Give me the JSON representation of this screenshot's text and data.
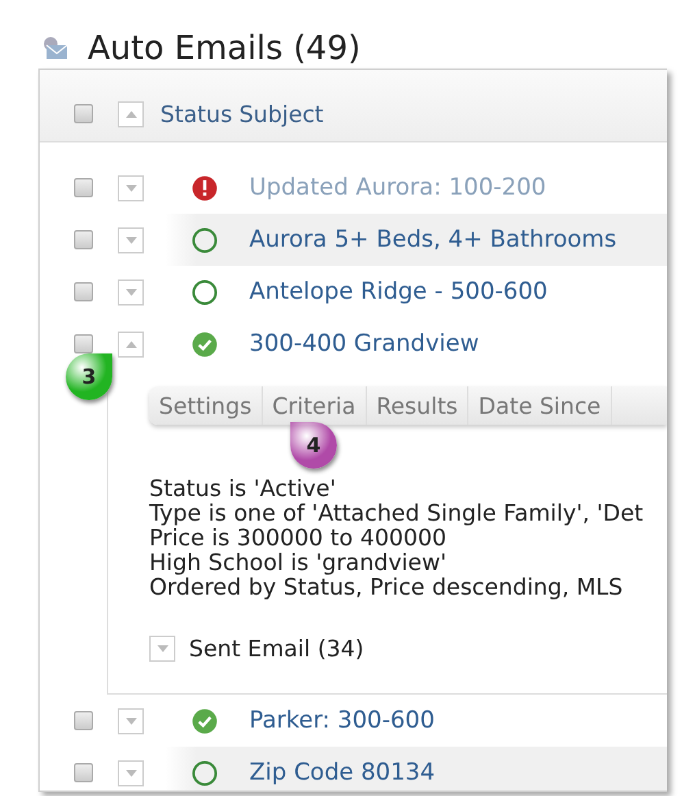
{
  "title": "Auto Emails (49)",
  "table": {
    "columns": [
      "Status",
      "Subject"
    ],
    "all_checked": false,
    "rows": [
      {
        "kind": "error",
        "subject": "Updated Aurora: 100-200",
        "checked": false,
        "expanded": false,
        "highlighted": false
      },
      {
        "kind": "inactive",
        "subject": "Aurora 5+ Beds, 4+ Bathrooms",
        "checked": false,
        "expanded": false,
        "highlighted": true
      },
      {
        "kind": "inactive",
        "subject": "Antelope Ridge - 500-600",
        "checked": false,
        "expanded": false,
        "highlighted": false
      },
      {
        "kind": "active",
        "subject": "300-400 Grandview",
        "checked": false,
        "expanded": true,
        "highlighted": false,
        "details": {
          "tabs": [
            {
              "label": "Settings",
              "selected": false
            },
            {
              "label": "Criteria",
              "selected": false
            },
            {
              "label": "Results",
              "selected": false
            },
            {
              "label": "Date Since",
              "selected": false
            }
          ],
          "criteria": [
            "Status is 'Active'",
            "Type is one of 'Attached Single Family', 'Det",
            "Price is 300000 to 400000",
            "High School is 'grandview'",
            "Ordered by Status, Price descending, MLS"
          ],
          "sent": {
            "label": "Sent Email (34)",
            "expanded": false
          }
        }
      },
      {
        "kind": "active",
        "subject": "Parker: 300-600",
        "checked": false,
        "expanded": false,
        "highlighted": false
      },
      {
        "kind": "inactive",
        "subject": "Zip Code 80134",
        "checked": false,
        "expanded": false,
        "highlighted": true
      }
    ]
  },
  "callouts": [
    {
      "label": "3",
      "color": "#22b422"
    },
    {
      "label": "4",
      "color": "#b04aa8"
    }
  ]
}
